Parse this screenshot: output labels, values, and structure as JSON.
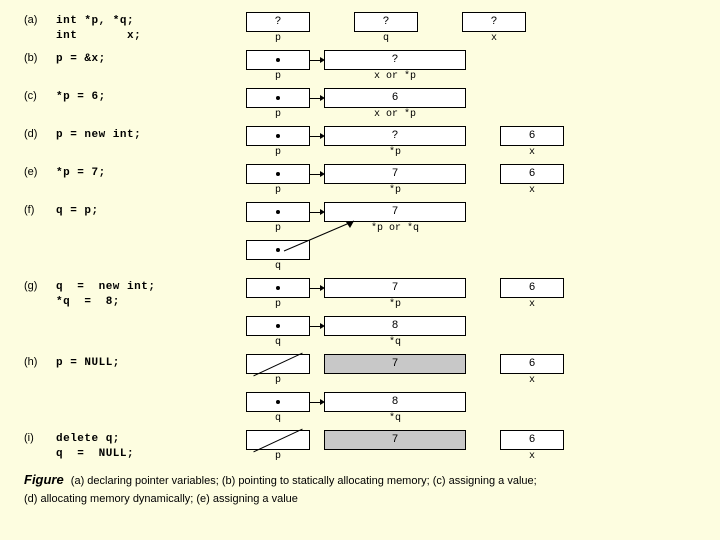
{
  "rows": {
    "a": {
      "label": "(a)",
      "code": "int *p, *q;\nint       x;",
      "cells": [
        {
          "val": "?",
          "cap": "p"
        },
        {
          "val": "?",
          "cap": "q"
        },
        {
          "val": "?",
          "cap": "x"
        }
      ]
    },
    "b": {
      "label": "(b)",
      "code": "p  =  &x;",
      "cells": [
        {
          "pointer": true,
          "cap": "p",
          "arrow": "right"
        },
        {
          "val": "?",
          "cap": "x  or  *p",
          "wide": true
        }
      ]
    },
    "c": {
      "label": "(c)",
      "code": "*p  =  6;",
      "cells": [
        {
          "pointer": true,
          "cap": "p",
          "arrow": "right"
        },
        {
          "val": "6",
          "cap": "x  or  *p",
          "wide": true
        }
      ]
    },
    "d": {
      "label": "(d)",
      "code": "p  =  new int;",
      "cells": [
        {
          "pointer": true,
          "cap": "p",
          "arrow": "right"
        },
        {
          "val": "?",
          "cap": "*p",
          "wide": true
        },
        {
          "val": "6",
          "cap": "x"
        }
      ]
    },
    "e": {
      "label": "(e)",
      "code": "*p  =  7;",
      "cells": [
        {
          "pointer": true,
          "cap": "p",
          "arrow": "right"
        },
        {
          "val": "7",
          "cap": "*p",
          "wide": true
        },
        {
          "val": "6",
          "cap": "x"
        }
      ]
    },
    "f": {
      "label": "(f)",
      "code": "q  =  p;",
      "cells_top": [
        {
          "pointer": true,
          "cap": "p",
          "arrow": "right"
        },
        {
          "val": "7",
          "cap": "*p  or  *q",
          "wide": true
        }
      ],
      "cells_bot": [
        {
          "pointer": true,
          "cap": "q",
          "arrow": "ne"
        }
      ]
    },
    "g": {
      "label": "(g)",
      "code": "q  =  new int;\n*q  =  8;",
      "cells_top": [
        {
          "pointer": true,
          "cap": "p",
          "arrow": "right"
        },
        {
          "val": "7",
          "cap": "*p",
          "wide": true
        },
        {
          "val": "6",
          "cap": "x"
        }
      ],
      "cells_bot": [
        {
          "pointer": true,
          "cap": "q",
          "arrow": "right"
        },
        {
          "val": "8",
          "cap": "*q",
          "wide": true
        }
      ]
    },
    "h": {
      "label": "(h)",
      "code": "p  =  NULL;",
      "cells_top": [
        {
          "null": true,
          "cap": "p"
        },
        {
          "val": "7",
          "cap": "",
          "wide": true,
          "grey": true
        },
        {
          "val": "6",
          "cap": "x"
        }
      ],
      "cells_bot": [
        {
          "pointer": true,
          "cap": "q",
          "arrow": "right"
        },
        {
          "val": "8",
          "cap": "*q",
          "wide": true
        }
      ]
    },
    "i": {
      "label": "(i)",
      "code": "delete q;\nq  =  NULL;",
      "cells": [
        {
          "null": true,
          "cap": "p"
        },
        {
          "val": "7",
          "cap": "",
          "wide": true,
          "grey": true
        },
        {
          "val": "6",
          "cap": "x"
        }
      ]
    }
  },
  "caption": {
    "figure": "Figure",
    "line1": "(a) declaring pointer variables; (b) pointing to statically allocating memory; (c) assigning a value;",
    "line2": "(d) allocating  memory dynamically; (e) assigning a value"
  }
}
